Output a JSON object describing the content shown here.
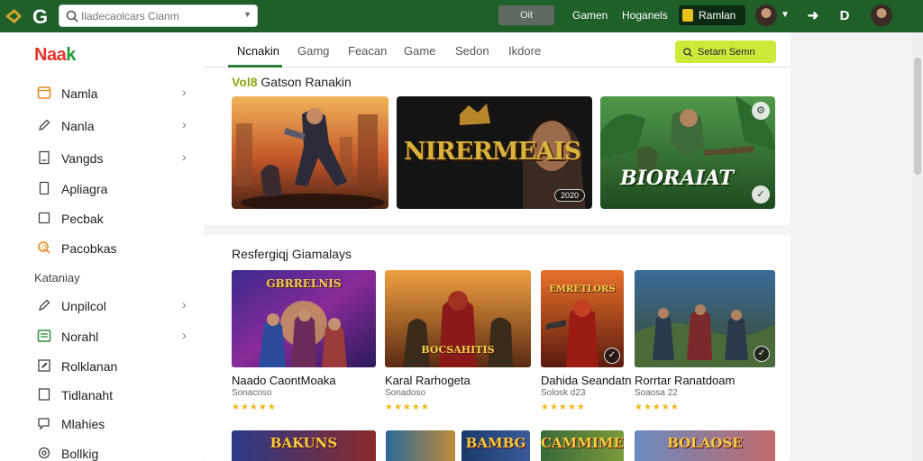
{
  "topbar": {
    "search_placeholder": "Iladecaolcars Cianm",
    "pill_label": "Oit",
    "links": [
      "Gamen",
      "Hoganels"
    ],
    "badge_label": "Ramlan"
  },
  "sidebar": {
    "brand": "Naak",
    "items": [
      {
        "label": "Namla",
        "icon": "window-icon",
        "chevron": true
      },
      {
        "label": "Nanla",
        "icon": "pen-icon",
        "chevron": true
      },
      {
        "label": "Vangds",
        "icon": "page-icon",
        "chevron": true
      },
      {
        "label": "Apliagra",
        "icon": "box-icon",
        "chevron": false
      },
      {
        "label": "Pecbak",
        "icon": "box-icon",
        "chevron": false
      },
      {
        "label": "Pacobkas",
        "icon": "magnifier-icon",
        "chevron": false
      }
    ],
    "section_label": "Kataniay",
    "items2": [
      {
        "label": "Unpilcol",
        "icon": "pen-icon",
        "chevron": true
      },
      {
        "label": "Norahl",
        "icon": "list-icon",
        "chevron": true
      },
      {
        "label": "Rolklanan",
        "icon": "edit-icon",
        "chevron": false
      },
      {
        "label": "Tidlanaht",
        "icon": "box-icon",
        "chevron": false
      },
      {
        "label": "Mlahies",
        "icon": "chat-icon",
        "chevron": false
      },
      {
        "label": "Bollkig",
        "icon": "gear-icon",
        "chevron": false
      }
    ]
  },
  "tabs": [
    "Ncnakin",
    "Gamg",
    "Feacan",
    "Game",
    "Sedon",
    "Ikdore"
  ],
  "yellow_button": "Setam Semn",
  "featured": {
    "title_prefix": "Vol8",
    "title_rest": "Gatson Ranakin",
    "banner2_text": "NIRERMEAIS",
    "banner2_chip": "2020",
    "banner3_text": "BIORAIAT"
  },
  "recommended": {
    "title": "Resfergiqj Giamalays",
    "cards": [
      {
        "art_text": "GBRRELNIS",
        "title": "Naado CaontMoaka",
        "sub": "Sonacoso",
        "stars": "★★★★★"
      },
      {
        "art_text": "BOCSAHITIS",
        "title": "Karal Rarhogeta",
        "sub": "Sonadoso",
        "stars": "★★★★★"
      },
      {
        "art_text": "EMRETLORS",
        "title": "Dahida Seandatn",
        "sub": "Solosk d23",
        "stars": "★★★★★"
      },
      {
        "art_text": "",
        "title": "Rorrtar Ranatdoam",
        "sub": "Soaosa 22",
        "stars": "★★★★★"
      }
    ],
    "bottom_row": [
      "BAKUNS",
      "",
      "BAMBG",
      "CAMMIME",
      "BOLAOSE"
    ]
  },
  "colors": {
    "topbar": "#1e5f2a",
    "accent_green": "#2f7d3a",
    "yellow": "#cdea3a",
    "star": "#f1b81c"
  }
}
